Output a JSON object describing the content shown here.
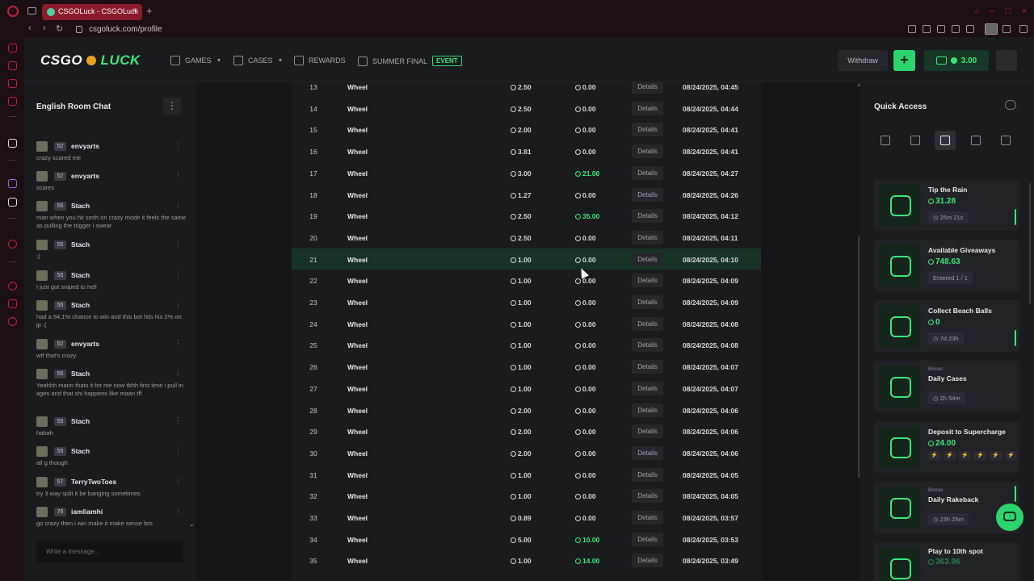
{
  "browser": {
    "tab_title": "CSGOLuck - CSGOLuck",
    "url": "csgoluck.com/profile",
    "new_tab": "+",
    "tab_close": "×",
    "back": "‹",
    "forward": "›",
    "reload": "↻",
    "win_min": "–",
    "win_max": "□",
    "win_close": "×"
  },
  "header": {
    "logo_part1": "CSGO",
    "logo_part2": "LUCK",
    "nav": {
      "games": "GAMES",
      "cases": "CASES",
      "rewards": "REWARDS",
      "summer": "SUMMER FINAL",
      "event": "EVENT"
    },
    "caret": "▼",
    "withdraw": "Withdraw",
    "deposit": "+",
    "balance": "3.00"
  },
  "chat": {
    "title": "English Room Chat",
    "menu": "⋮",
    "more": "⋮",
    "placeholder": "Write a message...",
    "scroll_down": "⌄",
    "messages": [
      {
        "level": "52",
        "name": "envyarts",
        "text": "crazy scared me"
      },
      {
        "level": "52",
        "name": "envyarts",
        "text": "scares"
      },
      {
        "level": "55",
        "name": "Stach",
        "text": "man when you hit smth on crazy mode it feels the same as pulling the trigger i swear"
      },
      {
        "level": "55",
        "name": "Stach",
        "text": ":("
      },
      {
        "level": "55",
        "name": "Stach",
        "text": "I just got sniped to hell"
      },
      {
        "level": "55",
        "name": "Stach",
        "text": "had a 94,1% chance to win and this bot hits his 2% on jp :("
      },
      {
        "level": "52",
        "name": "envyarts",
        "text": "wtf that's crazy"
      },
      {
        "level": "55",
        "name": "Stach",
        "text": "Yeahhh mann thats it for me now tbhh first time i pull in ages and that shi happens like maan tff"
      },
      {
        "level": "55",
        "name": "Stach",
        "text": "hahah"
      },
      {
        "level": "55",
        "name": "Stach",
        "text": "all g though"
      },
      {
        "level": "57",
        "name": "TerryTwoToes",
        "text": "try 3 way split it be banging sometimes"
      },
      {
        "level": "76",
        "name": "iamliamhi",
        "text": "go crazy then i win make it make sense bro"
      }
    ]
  },
  "history": {
    "details_label": "Details",
    "rows": [
      {
        "id": "13",
        "game": "Wheel",
        "bet": "2.50",
        "win": "0.00",
        "date": "08/24/2025, 04:45",
        "positive": false
      },
      {
        "id": "14",
        "game": "Wheel",
        "bet": "2.50",
        "win": "0.00",
        "date": "08/24/2025, 04:44",
        "positive": false
      },
      {
        "id": "15",
        "game": "Wheel",
        "bet": "2.00",
        "win": "0.00",
        "date": "08/24/2025, 04:41",
        "positive": false
      },
      {
        "id": "16",
        "game": "Wheel",
        "bet": "3.81",
        "win": "0.00",
        "date": "08/24/2025, 04:41",
        "positive": false
      },
      {
        "id": "17",
        "game": "Wheel",
        "bet": "3.00",
        "win": "21.00",
        "date": "08/24/2025, 04:27",
        "positive": true
      },
      {
        "id": "18",
        "game": "Wheel",
        "bet": "1.27",
        "win": "0.00",
        "date": "08/24/2025, 04:26",
        "positive": false
      },
      {
        "id": "19",
        "game": "Wheel",
        "bet": "2.50",
        "win": "35.00",
        "date": "08/24/2025, 04:12",
        "positive": true
      },
      {
        "id": "20",
        "game": "Wheel",
        "bet": "2.50",
        "win": "0.00",
        "date": "08/24/2025, 04:11",
        "positive": false
      },
      {
        "id": "21",
        "game": "Wheel",
        "bet": "1.00",
        "win": "0.00",
        "date": "08/24/2025, 04:10",
        "positive": false,
        "highlight": true
      },
      {
        "id": "22",
        "game": "Wheel",
        "bet": "1.00",
        "win": "0.00",
        "date": "08/24/2025, 04:09",
        "positive": false
      },
      {
        "id": "23",
        "game": "Wheel",
        "bet": "1.00",
        "win": "0.00",
        "date": "08/24/2025, 04:09",
        "positive": false
      },
      {
        "id": "24",
        "game": "Wheel",
        "bet": "1.00",
        "win": "0.00",
        "date": "08/24/2025, 04:08",
        "positive": false
      },
      {
        "id": "25",
        "game": "Wheel",
        "bet": "1.00",
        "win": "0.00",
        "date": "08/24/2025, 04:08",
        "positive": false
      },
      {
        "id": "26",
        "game": "Wheel",
        "bet": "1.00",
        "win": "0.00",
        "date": "08/24/2025, 04:07",
        "positive": false
      },
      {
        "id": "27",
        "game": "Wheel",
        "bet": "1.00",
        "win": "0.00",
        "date": "08/24/2025, 04:07",
        "positive": false
      },
      {
        "id": "28",
        "game": "Wheel",
        "bet": "2.00",
        "win": "0.00",
        "date": "08/24/2025, 04:06",
        "positive": false
      },
      {
        "id": "29",
        "game": "Wheel",
        "bet": "2.00",
        "win": "0.00",
        "date": "08/24/2025, 04:06",
        "positive": false
      },
      {
        "id": "30",
        "game": "Wheel",
        "bet": "2.00",
        "win": "0.00",
        "date": "08/24/2025, 04:06",
        "positive": false
      },
      {
        "id": "31",
        "game": "Wheel",
        "bet": "1.00",
        "win": "0.00",
        "date": "08/24/2025, 04:05",
        "positive": false
      },
      {
        "id": "32",
        "game": "Wheel",
        "bet": "1.00",
        "win": "0.00",
        "date": "08/24/2025, 04:05",
        "positive": false
      },
      {
        "id": "33",
        "game": "Wheel",
        "bet": "0.89",
        "win": "0.00",
        "date": "08/24/2025, 03:57",
        "positive": false
      },
      {
        "id": "34",
        "game": "Wheel",
        "bet": "5.00",
        "win": "10.00",
        "date": "08/24/2025, 03:53",
        "positive": true
      },
      {
        "id": "35",
        "game": "Wheel",
        "bet": "1.00",
        "win": "14.00",
        "date": "08/24/2025, 03:49",
        "positive": true
      }
    ]
  },
  "quick_access": {
    "title": "Quick Access",
    "tabs": [
      "warning-icon",
      "gift-icon",
      "profile-icon",
      "shield-icon",
      "discord-icon"
    ],
    "cards": {
      "rain": {
        "label": "Tip the Rain",
        "amount": "31.28",
        "timer": "25m 21s"
      },
      "giveaways": {
        "label": "Available Giveaways",
        "amount": "748.63",
        "status": "Entered 1 / 1"
      },
      "beach": {
        "label": "Collect Beach Balls",
        "amount": "0",
        "timer": "7d 23h"
      },
      "daily_cases": {
        "sub": "Bonus",
        "label": "Daily Cases",
        "timer": "2h 54m"
      },
      "supercharge": {
        "label": "Deposit to Supercharge",
        "amount": "24.00"
      },
      "rakeback": {
        "sub": "Bonus",
        "label": "Daily Rakeback",
        "timer": "23h 25m"
      },
      "race": {
        "label": "Play to 10th spot",
        "amount": "363.96"
      }
    }
  },
  "colors": {
    "accent": "#3ae87a",
    "brand_red": "#c0213a"
  }
}
